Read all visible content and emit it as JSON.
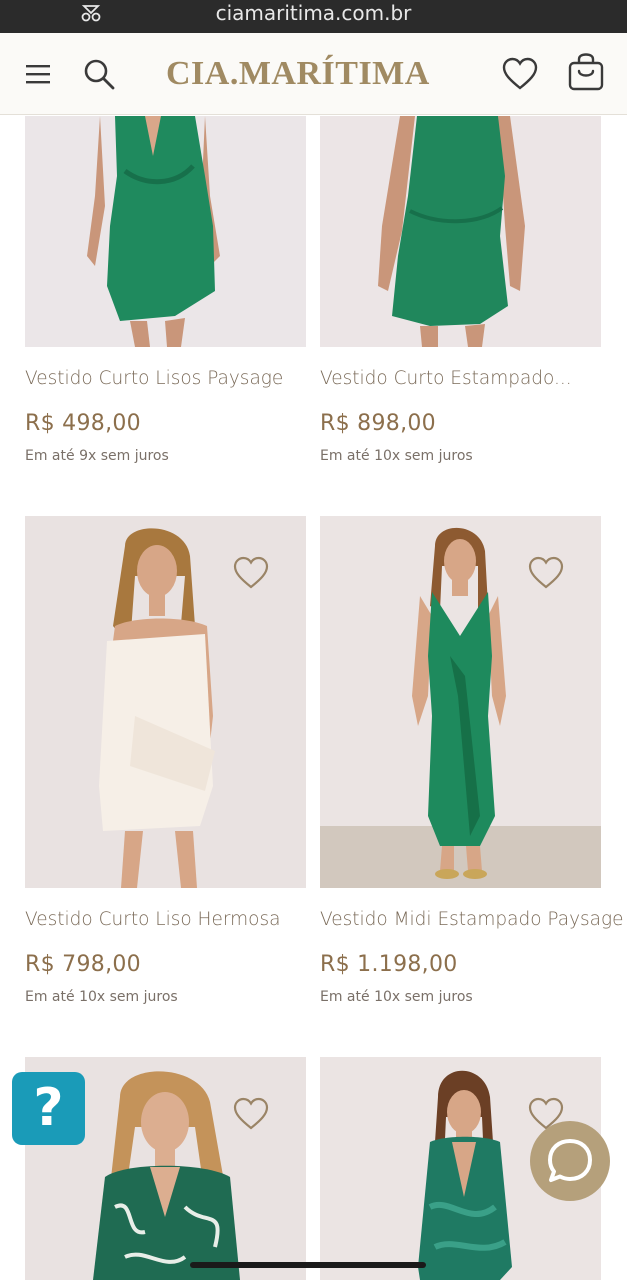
{
  "browser": {
    "url": "ciamaritima.com.br"
  },
  "header": {
    "logo_text": "CIA.MARÍTIMA",
    "menu_icon": "menu-icon",
    "search_icon": "search-icon",
    "wishlist_icon": "heart-icon",
    "bag_icon": "shopping-bag-icon"
  },
  "products": [
    {
      "name": "Vestido Curto Lisos Paysage",
      "price": "R$ 498,00",
      "installments": "Em até 9x sem juros"
    },
    {
      "name": "Vestido Curto Estampado...",
      "price": "R$ 898,00",
      "installments": "Em até 10x sem juros"
    },
    {
      "name": "Vestido Curto Liso Hermosa",
      "price": "R$ 798,00",
      "installments": "Em até 10x sem juros"
    },
    {
      "name": "Vestido Midi Estampado Paysage",
      "price": "R$ 1.198,00",
      "installments": "Em até 10x sem juros"
    },
    {
      "name": "",
      "price": "",
      "installments": ""
    },
    {
      "name": "",
      "price": "",
      "installments": ""
    }
  ],
  "help_button": {
    "label": "?"
  },
  "colors": {
    "brand": "#a08a62",
    "price": "#8c6f4c",
    "help": "#1a9bb8",
    "chat": "#b5a07b"
  }
}
